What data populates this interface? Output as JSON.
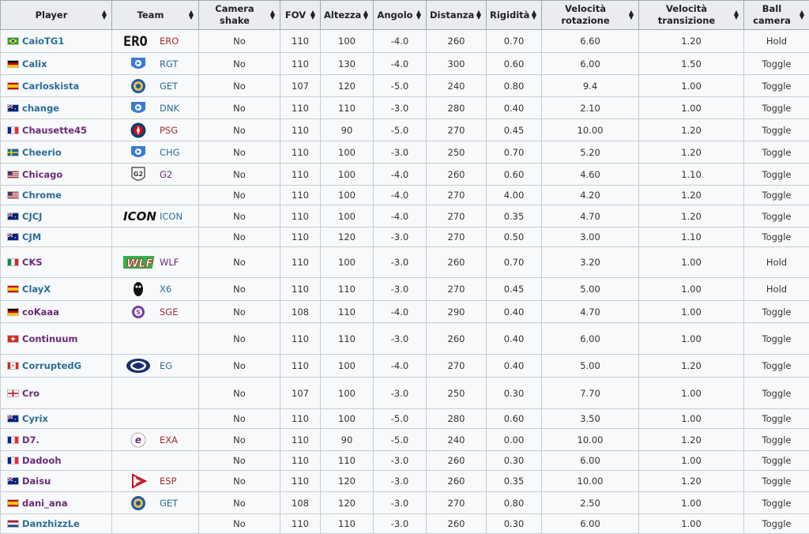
{
  "headers": [
    {
      "label": "Player"
    },
    {
      "label": "Team"
    },
    {
      "label": "Camera shake"
    },
    {
      "label": "FOV"
    },
    {
      "label": "Altezza"
    },
    {
      "label": "Angolo"
    },
    {
      "label": "Distanza"
    },
    {
      "label": "Rigidità"
    },
    {
      "label": "Velocità rotazione"
    },
    {
      "label": "Velocità transizione"
    },
    {
      "label": "Ball camera"
    }
  ],
  "rows": [
    {
      "player": "CaioTG1",
      "flag": "br",
      "team": "ERO",
      "logo": "ero",
      "shake": "No",
      "fov": "110",
      "height": "100",
      "angle": "-4.0",
      "distance": "260",
      "stiffness": "0.70",
      "swivel": "6.60",
      "transition": "1.20",
      "ball": "Hold"
    },
    {
      "player": "Calix",
      "flag": "de",
      "team": "RGT",
      "logo": "rl",
      "shake": "No",
      "fov": "110",
      "height": "130",
      "angle": "-4.0",
      "distance": "300",
      "stiffness": "0.60",
      "swivel": "6.00",
      "transition": "1.50",
      "ball": "Toggle"
    },
    {
      "player": "Carloskista",
      "flag": "es",
      "team": "GET",
      "logo": "get",
      "shake": "No",
      "fov": "107",
      "height": "120",
      "angle": "-5.0",
      "distance": "240",
      "stiffness": "0.80",
      "swivel": "9.4",
      "transition": "1.00",
      "ball": "Toggle"
    },
    {
      "player": "change",
      "flag": "au",
      "team": "DNK",
      "logo": "rl",
      "shake": "No",
      "fov": "110",
      "height": "110",
      "angle": "-3.0",
      "distance": "280",
      "stiffness": "0.40",
      "swivel": "2.10",
      "transition": "1.00",
      "ball": "Toggle"
    },
    {
      "player": "Chausette45",
      "flag": "fr",
      "team": "PSG",
      "logo": "psg",
      "shake": "No",
      "fov": "110",
      "height": "90",
      "angle": "-5.0",
      "distance": "270",
      "stiffness": "0.45",
      "swivel": "10.00",
      "transition": "1.20",
      "ball": "Toggle"
    },
    {
      "player": "Cheerio",
      "flag": "se",
      "team": "CHG",
      "logo": "rl",
      "shake": "No",
      "fov": "110",
      "height": "100",
      "angle": "-3.0",
      "distance": "250",
      "stiffness": "0.70",
      "swivel": "5.20",
      "transition": "1.20",
      "ball": "Toggle"
    },
    {
      "player": "Chicago",
      "flag": "us",
      "team": "G2",
      "logo": "g2",
      "shake": "No",
      "fov": "110",
      "height": "100",
      "angle": "-4.0",
      "distance": "260",
      "stiffness": "0.60",
      "swivel": "4.60",
      "transition": "1.10",
      "ball": "Toggle"
    },
    {
      "player": "Chrome",
      "flag": "us",
      "team": "",
      "logo": "",
      "shake": "No",
      "fov": "110",
      "height": "100",
      "angle": "-4.0",
      "distance": "270",
      "stiffness": "4.00",
      "swivel": "4.20",
      "transition": "1.20",
      "ball": "Toggle"
    },
    {
      "player": "CJCJ",
      "flag": "au",
      "team": "ICON",
      "logo": "icon",
      "shake": "No",
      "fov": "110",
      "height": "100",
      "angle": "-4.0",
      "distance": "270",
      "stiffness": "0.35",
      "swivel": "4.70",
      "transition": "1.20",
      "ball": "Toggle"
    },
    {
      "player": "CJM",
      "flag": "au",
      "team": "",
      "logo": "",
      "shake": "No",
      "fov": "110",
      "height": "120",
      "angle": "-3.0",
      "distance": "270",
      "stiffness": "0.50",
      "swivel": "3.00",
      "transition": "1.10",
      "ball": "Toggle"
    },
    {
      "player": "CKS",
      "flag": "it",
      "team": "WLF",
      "logo": "wlf",
      "shake": "No",
      "fov": "110",
      "height": "100",
      "angle": "-3.0",
      "distance": "260",
      "stiffness": "0.70",
      "swivel": "3.20",
      "transition": "1.00",
      "ball": "Hold"
    },
    {
      "player": "ClayX",
      "flag": "es",
      "team": "X6",
      "logo": "x6",
      "shake": "No",
      "fov": "110",
      "height": "110",
      "angle": "-3.0",
      "distance": "270",
      "stiffness": "0.45",
      "swivel": "5.00",
      "transition": "1.00",
      "ball": "Hold"
    },
    {
      "player": "coKaaa",
      "flag": "de",
      "team": "SGE",
      "logo": "sge",
      "shake": "No",
      "fov": "108",
      "height": "110",
      "angle": "-4.0",
      "distance": "290",
      "stiffness": "0.40",
      "swivel": "4.70",
      "transition": "1.00",
      "ball": "Toggle"
    },
    {
      "player": "Continuum",
      "flag": "ch",
      "team": "",
      "logo": "",
      "shake": "No",
      "fov": "110",
      "height": "110",
      "angle": "-3.0",
      "distance": "260",
      "stiffness": "0.40",
      "swivel": "6.00",
      "transition": "1.00",
      "ball": "Toggle"
    },
    {
      "player": "CorruptedG",
      "flag": "ca",
      "team": "EG",
      "logo": "eg",
      "shake": "No",
      "fov": "110",
      "height": "100",
      "angle": "-4.0",
      "distance": "270",
      "stiffness": "0.40",
      "swivel": "5.00",
      "transition": "1.20",
      "ball": "Toggle"
    },
    {
      "player": "Cro",
      "flag": "gb",
      "team": "",
      "logo": "",
      "shake": "No",
      "fov": "107",
      "height": "100",
      "angle": "-3.0",
      "distance": "250",
      "stiffness": "0.30",
      "swivel": "7.70",
      "transition": "1.00",
      "ball": "Toggle"
    },
    {
      "player": "Cyrix",
      "flag": "au",
      "team": "",
      "logo": "",
      "shake": "No",
      "fov": "110",
      "height": "100",
      "angle": "-5.0",
      "distance": "280",
      "stiffness": "0.60",
      "swivel": "3.50",
      "transition": "1.00",
      "ball": "Toggle"
    },
    {
      "player": "D7.",
      "flag": "fr",
      "team": "EXA",
      "logo": "exa",
      "shake": "No",
      "fov": "110",
      "height": "90",
      "angle": "-5.0",
      "distance": "240",
      "stiffness": "0.00",
      "swivel": "10.00",
      "transition": "1.20",
      "ball": "Toggle"
    },
    {
      "player": "Dadooh",
      "flag": "fr",
      "team": "",
      "logo": "",
      "shake": "No",
      "fov": "110",
      "height": "110",
      "angle": "-3.0",
      "distance": "260",
      "stiffness": "0.30",
      "swivel": "6.00",
      "transition": "1.00",
      "ball": "Toggle"
    },
    {
      "player": "Daisu",
      "flag": "au",
      "team": "ESP",
      "logo": "esp",
      "shake": "No",
      "fov": "110",
      "height": "120",
      "angle": "-3.0",
      "distance": "260",
      "stiffness": "0.35",
      "swivel": "10.00",
      "transition": "1.20",
      "ball": "Toggle"
    },
    {
      "player": "dani_ana",
      "flag": "es",
      "team": "GET",
      "logo": "get",
      "shake": "No",
      "fov": "108",
      "height": "120",
      "angle": "-3.0",
      "distance": "270",
      "stiffness": "0.80",
      "swivel": "2.50",
      "transition": "1.00",
      "ball": "Toggle"
    },
    {
      "player": "DanzhizzLe",
      "flag": "nl",
      "team": "",
      "logo": "",
      "shake": "No",
      "fov": "110",
      "height": "110",
      "angle": "-3.0",
      "distance": "260",
      "stiffness": "0.30",
      "swivel": "6.00",
      "transition": "1.00",
      "ball": "Toggle"
    }
  ]
}
